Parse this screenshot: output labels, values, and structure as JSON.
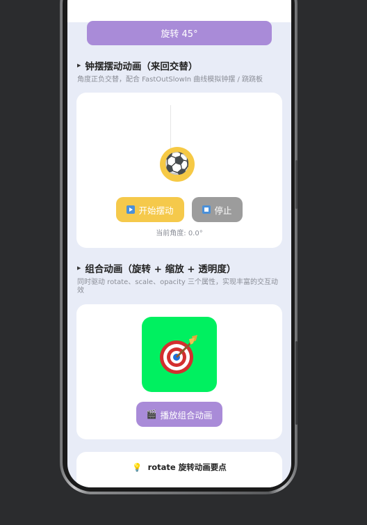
{
  "top_button": {
    "label": "旋转 45°"
  },
  "pendulum": {
    "title": "钟摆摆动动画（来回交替）",
    "description": "角度正负交替，配合 FastOutSlowIn 曲线模拟钟摆 / 跷跷板",
    "ball_emoji": "⚽",
    "start_label": "开始摆动",
    "stop_label": "停止",
    "angle_text": "当前角度: 0.0°"
  },
  "combo": {
    "title": "组合动画（旋转 + 缩放 + 透明度）",
    "description": "同时驱动 rotate、scale、opacity 三个属性，实现丰富的交互动效",
    "play_label": "播放组合动画",
    "box_color": "#00f060"
  },
  "tips": {
    "title": "rotate 旋转动画要点"
  },
  "colors": {
    "accent_purple": "#a98bd8",
    "accent_yellow": "#f5c94b",
    "stop_gray": "#9c9c9c",
    "page_bg": "#e8ecf7"
  },
  "icons": [
    "play-icon",
    "stop-icon",
    "clapper-icon",
    "target-icon",
    "bulb-icon",
    "soccer-ball-icon"
  ]
}
